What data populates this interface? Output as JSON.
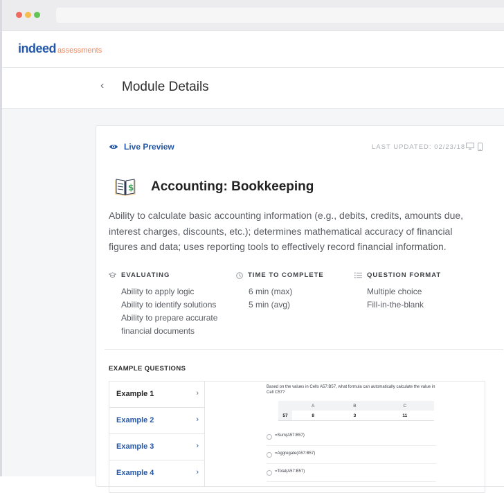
{
  "browser": {
    "dots": [
      "#ee6a5e",
      "#f5bd4f",
      "#61c454"
    ]
  },
  "brand": {
    "name": "indeed",
    "suffix": "assessments",
    "primary_color": "#2557a7",
    "accent_color": "#f0845b"
  },
  "header": {
    "back_icon": "chevron-left-icon",
    "title": "Module Details"
  },
  "card": {
    "live_preview_label": "Live Preview",
    "last_updated": "LAST UPDATED: 02/23/18",
    "module_icon": "accounting-book-icon",
    "module_title": "Accounting: Bookkeeping",
    "description": "Ability to calculate basic accounting information (e.g., debits, credits, amounts due, interest charges, discounts, etc.); determines mathematical accuracy of financial figures and data; uses reporting tools to effectively record financial information.",
    "evaluating": {
      "heading": "EVALUATING",
      "icon": "graduation-cap-icon",
      "items": [
        "Ability to apply logic",
        "Ability to identify solutions",
        "Ability to prepare accurate",
        "financial documents"
      ]
    },
    "time": {
      "heading": "TIME TO COMPLETE",
      "icon": "clock-icon",
      "items": [
        "6 min (max)",
        "5 min (avg)"
      ]
    },
    "format": {
      "heading": "QUESTION FORMAT",
      "icon": "list-icon",
      "items": [
        "Multiple choice",
        "Fill-in-the-blank"
      ]
    }
  },
  "examples": {
    "heading": "EXAMPLE QUESTIONS",
    "items": [
      {
        "label": "Example 1"
      },
      {
        "label": "Example 2"
      },
      {
        "label": "Example 3"
      },
      {
        "label": "Example 4"
      }
    ],
    "question": "Based on the values in Cells A57:B57, what formula can automatically calculate the value in Cell C57?",
    "table": {
      "columns": [
        "A",
        "B",
        "C"
      ],
      "row_label": "57",
      "values": [
        "8",
        "3",
        "11"
      ]
    },
    "options": [
      "=Sum(A57:B57)",
      "=Aggregate(A57:B57)",
      "=Total(A57:B57)"
    ]
  }
}
